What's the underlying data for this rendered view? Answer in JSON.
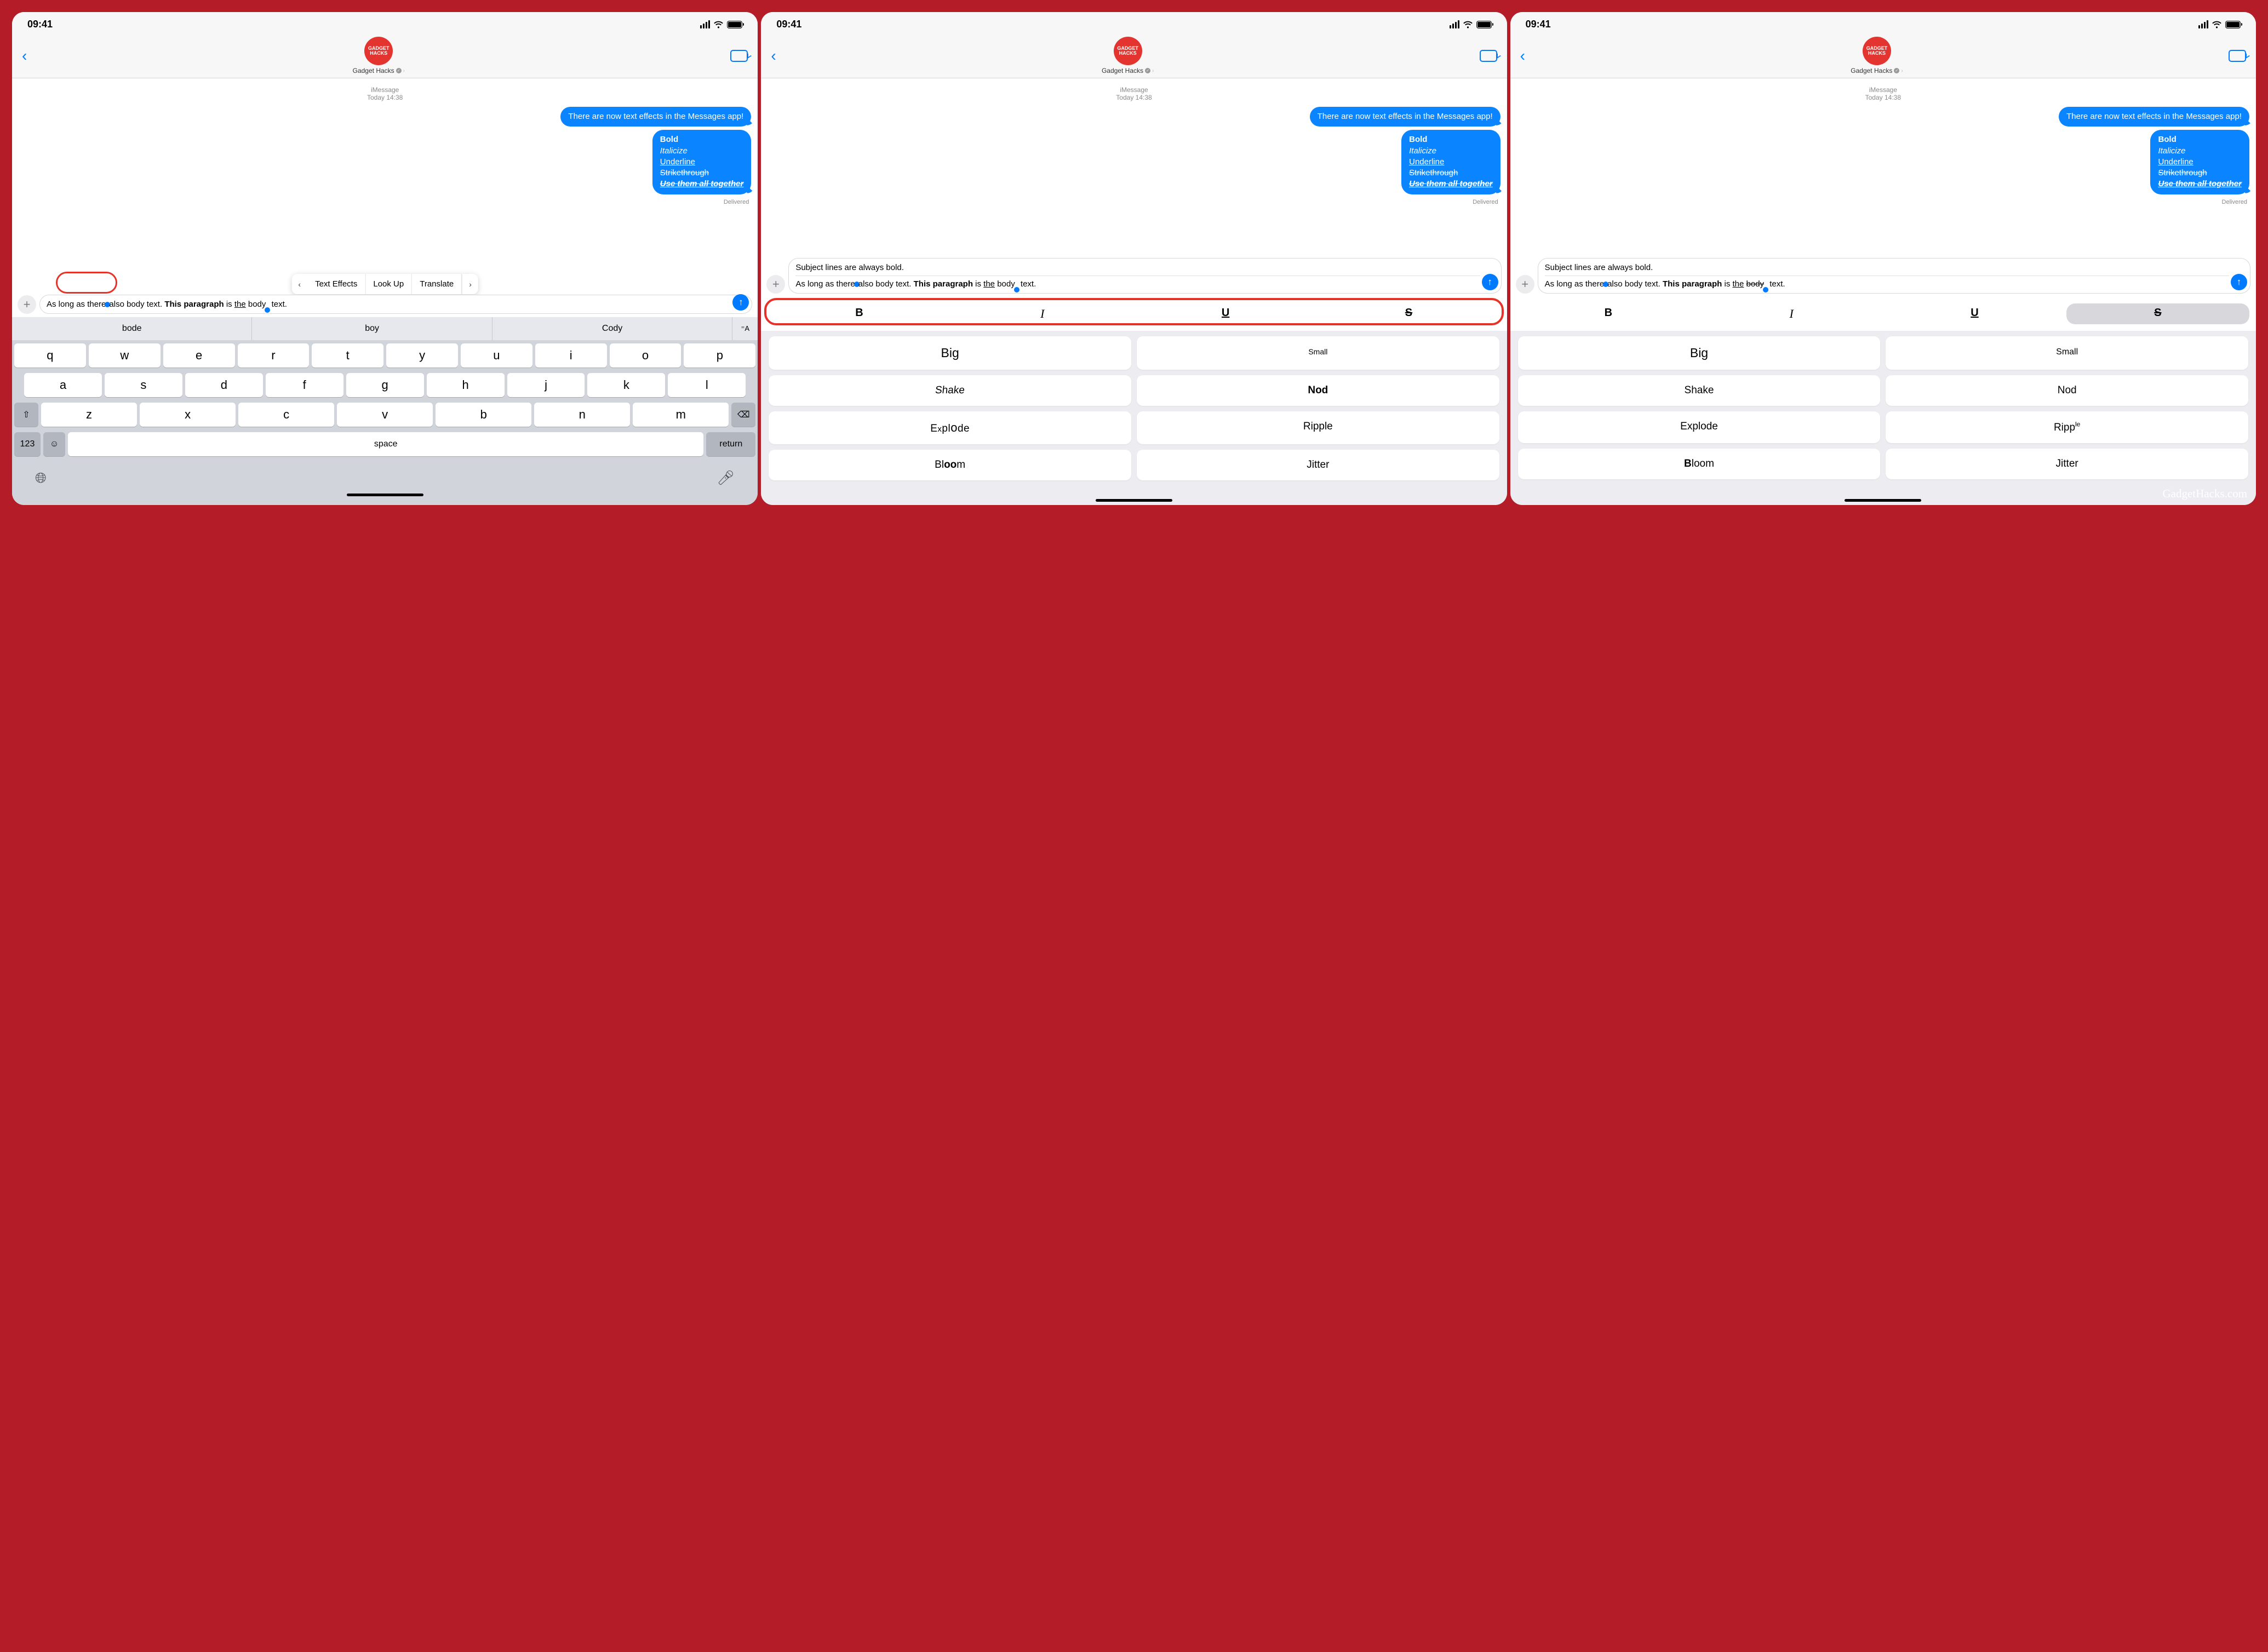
{
  "status": {
    "time": "09:41"
  },
  "contact": {
    "name": "Gadget Hacks",
    "avatar_top": "GADGET",
    "avatar_bottom": "HACKS"
  },
  "timestamp": {
    "service": "iMessage",
    "when": "Today 14:38"
  },
  "bubble1": "There are now text effects in the Messages app!",
  "bubble2": {
    "l1": "Bold",
    "l2": "Italicize",
    "l3": "Underline",
    "l4": "Strikethrough",
    "l5": "Use them all together"
  },
  "delivered": "Delivered",
  "compose": {
    "subject": "Subject lines are always bold.",
    "body_pre": "As long as there",
    "body_mid": "also body text. ",
    "body_this": "This paragraph",
    "body_is": " is ",
    "body_the": "the",
    "body_space": " ",
    "body_body": "body",
    "body_tail": " text."
  },
  "callout": {
    "prev": "‹",
    "text_effects": "Text Effects",
    "look_up": "Look Up",
    "translate": "Translate",
    "next": "›"
  },
  "suggestions": {
    "a": "bode",
    "b": "boy",
    "c": "Cody"
  },
  "keyboard": {
    "row1": [
      "q",
      "w",
      "e",
      "r",
      "t",
      "y",
      "u",
      "i",
      "o",
      "p"
    ],
    "row2": [
      "a",
      "s",
      "d",
      "f",
      "g",
      "h",
      "j",
      "k",
      "l"
    ],
    "row3": [
      "z",
      "x",
      "c",
      "v",
      "b",
      "n",
      "m"
    ],
    "num": "123",
    "space": "space",
    "return": "return"
  },
  "format": {
    "bold": "B",
    "italic": "I",
    "underline": "U",
    "strike": "S"
  },
  "effects": {
    "big": "Big",
    "small": "Small",
    "shake": "Shake",
    "nod": "Nod",
    "explode": "Explode",
    "ripple": "Ripple",
    "bloom": "Bloom",
    "jitter": "Jitter"
  },
  "watermark": "GadgetHacks.com"
}
